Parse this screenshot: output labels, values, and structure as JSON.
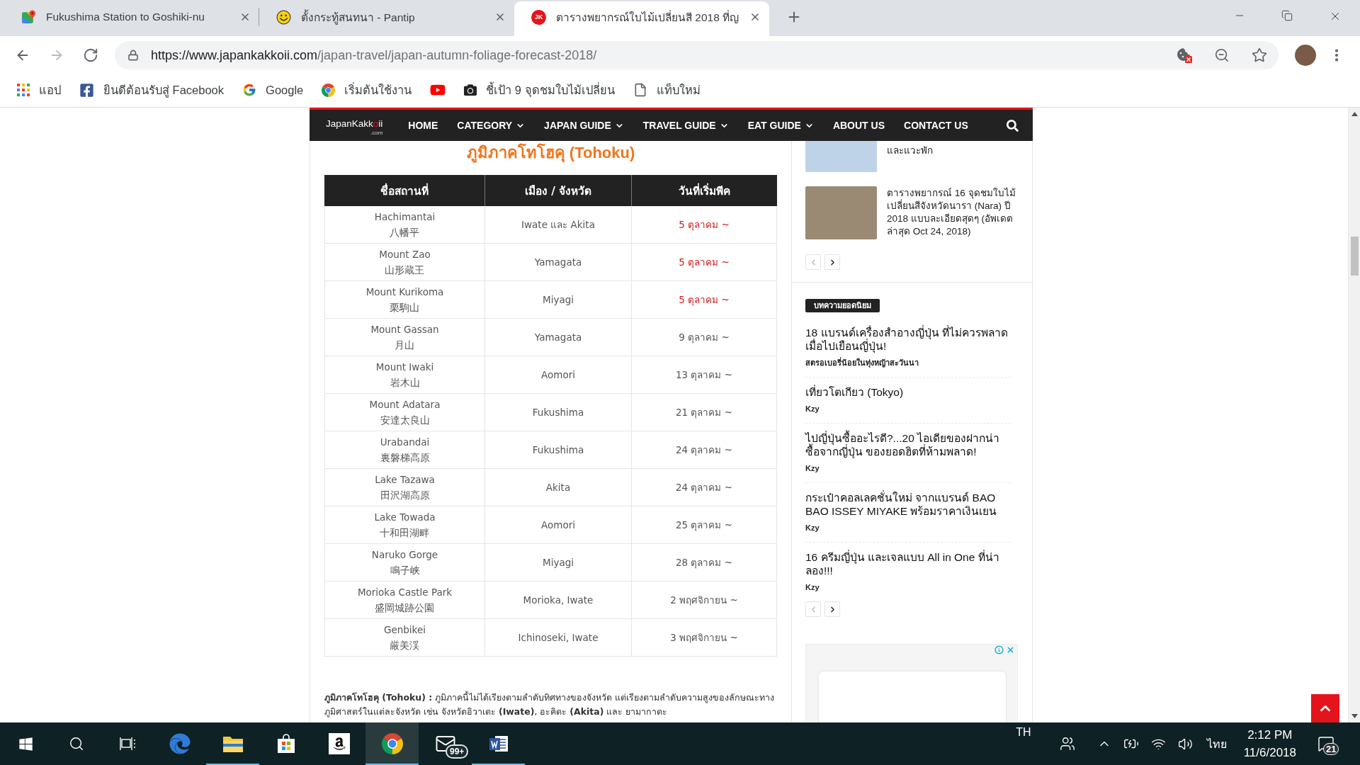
{
  "browser": {
    "tabs": [
      {
        "kind": "maps",
        "title": "Fukushima Station to Goshiki-nu",
        "selected": false
      },
      {
        "kind": "pantip",
        "title": "ตั้งกระทู้สนทนา - Pantip",
        "selected": false
      },
      {
        "kind": "site",
        "favicon_text": "JK",
        "title": "ตารางพยากรณ์ใบไม้เปลี่ยนสี 2018 ที่ญ",
        "selected": true
      }
    ],
    "nav_buttons": [
      {
        "kind": "back",
        "disabled": false
      },
      {
        "kind": "forward",
        "disabled": true
      },
      {
        "kind": "reload",
        "disabled": false
      }
    ],
    "address": {
      "host": "https://www.japankakkoii.com",
      "path": "/japan-travel/japan-autumn-foliage-forecast-2018/"
    },
    "bookmarks": [
      {
        "kind": "apps",
        "label": "แอป"
      },
      {
        "kind": "facebook",
        "label": "ยินดีต้อนรับสู่ Facebook"
      },
      {
        "kind": "google",
        "label": "Google"
      },
      {
        "kind": "chrome",
        "label": "เริ่มต้นใช้งาน"
      },
      {
        "kind": "youtube"
      },
      {
        "kind": "camera",
        "label": "ชี้เป้า 9 จุดชมใบไม้เปลี่ยน"
      },
      {
        "kind": "page",
        "label": "แท็บใหม่"
      }
    ]
  },
  "site": {
    "logo": {
      "text": "JapanKakkoii",
      "sub": ".com"
    },
    "nav": [
      {
        "label": "HOME",
        "dropdown": false
      },
      {
        "label": "CATEGORY",
        "dropdown": true
      },
      {
        "label": "JAPAN GUIDE",
        "dropdown": true
      },
      {
        "label": "TRAVEL GUIDE",
        "dropdown": true
      },
      {
        "label": "EAT GUIDE",
        "dropdown": true
      },
      {
        "label": "ABOUT US",
        "dropdown": false
      },
      {
        "label": "CONTACT US",
        "dropdown": false
      }
    ]
  },
  "article": {
    "heading": "ภูมิภาคโทโฮคุ (Tohoku)",
    "table": {
      "columns": [
        "ชื่อสถานที่",
        "เมือง / จังหวัด",
        "วันที่เริ่มพีค"
      ],
      "rows": [
        {
          "name": "Hachimantai",
          "name_ja": "八幡平",
          "area": "Iwate และ Akita",
          "date": "5 ตุลาคม ~",
          "highlighted": true
        },
        {
          "name": "Mount Zao",
          "name_ja": "山形蔵王",
          "area": "Yamagata",
          "date": "5 ตุลาคม ~",
          "highlighted": true
        },
        {
          "name": "Mount Kurikoma",
          "name_ja": "栗駒山",
          "area": "Miyagi",
          "date": "5 ตุลาคม ~",
          "highlighted": true
        },
        {
          "name": "Mount Gassan",
          "name_ja": "月山",
          "area": "Yamagata",
          "date": "9 ตุลาคม ~",
          "highlighted": false
        },
        {
          "name": "Mount Iwaki",
          "name_ja": "岩木山",
          "area": "Aomori",
          "date": "13 ตุลาคม ~",
          "highlighted": false
        },
        {
          "name": "Mount Adatara",
          "name_ja": "安達太良山",
          "area": "Fukushima",
          "date": "21 ตุลาคม ~",
          "highlighted": false
        },
        {
          "name": "Urabandai",
          "name_ja": "裏磐梯高原",
          "area": "Fukushima",
          "date": "24 ตุลาคม ~",
          "highlighted": false
        },
        {
          "name": "Lake Tazawa",
          "name_ja": "田沢湖高原",
          "area": "Akita",
          "date": "24 ตุลาคม ~",
          "highlighted": false
        },
        {
          "name": "Lake Towada",
          "name_ja": "十和田湖畔",
          "area": "Aomori",
          "date": "25 ตุลาคม ~",
          "highlighted": false
        },
        {
          "name": "Naruko Gorge",
          "name_ja": "鳴子峡",
          "area": "Miyagi",
          "date": "28 ตุลาคม ~",
          "highlighted": false
        },
        {
          "name": "Morioka Castle Park",
          "name_ja": "盛岡城跡公園",
          "area": "Morioka, Iwate",
          "date": "2 พฤศจิกายน ~",
          "highlighted": false
        },
        {
          "name": "Genbikei",
          "name_ja": "厳美渓",
          "area": "Ichinoseki, Iwate",
          "date": "3 พฤศจิกายน ~",
          "highlighted": false
        }
      ]
    },
    "paragraph": "**ภูมิภาคโทโฮคุ (Tohoku) :** ภูมิภาคนี้ไม่ได้เรียงตามลำดับทิศทางของจังหวัด แต่เรียงตามลำดับความสูงของลักษณะทางภูมิศาสตร์ในแต่ละจังหวัด เช่น จังหวัดอิวาเตะ **(Iwate)**, อะคิตะ **(Akita)** และ ยามากาตะ"
  },
  "sidebar": {
    "related": [
      {
        "kind": "clipped",
        "title": "และแวะพัก"
      },
      {
        "kind": "full",
        "title": "ตารางพยากรณ์ 16 จุดชมใบไม้เปลี่ยนสีจังหวัดนารา (Nara) ปี 2018 แบบละเอียดสุดๆ (อัพเดตล่าสุด Oct 24, 2018)"
      }
    ],
    "related_pager": [
      {
        "kind": "prev",
        "disabled": true
      },
      {
        "kind": "next",
        "disabled": false
      }
    ],
    "popular": {
      "heading": "บทความยอดนิยม",
      "items": [
        {
          "title": "18 แบรนด์เครื่องสำอางญี่ปุ่น ที่ไม่ควรพลาดเมื่อไปเยือนญี่ปุ่น!",
          "author": "สตรอเบอรี่น้อยในทุ่งหญ้าสะวันนา"
        },
        {
          "title": "เที่ยวโตเกียว (Tokyo)",
          "author": "Kzy"
        },
        {
          "title": "ไปญี่ปุ่นซื้ออะไรดี?...20 ไอเดียของฝากน่าซื้อจากญี่ปุ่น ของยอดฮิตที่ห้ามพลาด!",
          "author": "Kzy"
        },
        {
          "title": "กระเป๋าคอลเลคชั่นใหม่ จากแบรนด์ BAO BAO ISSEY MIYAKE พร้อมราคาเงินเยน",
          "author": "Kzy"
        },
        {
          "title": "16 ครีมญี่ปุ่น และเจลแบบ All in One ที่น่าลอง!!!",
          "author": "Kzy"
        }
      ]
    },
    "popular_pager": [
      {
        "kind": "prev",
        "disabled": true
      },
      {
        "kind": "next",
        "disabled": false
      }
    ]
  },
  "taskbar": {
    "apps": [
      {
        "kind": "start",
        "running": false,
        "active": false
      },
      {
        "kind": "search",
        "running": false,
        "active": false
      },
      {
        "kind": "taskview",
        "running": false,
        "active": false
      },
      {
        "kind": "edge",
        "running": false,
        "active": false
      },
      {
        "kind": "explorer",
        "running": true,
        "active": false
      },
      {
        "kind": "store",
        "running": false,
        "active": false
      },
      {
        "kind": "amazon",
        "running": false,
        "active": false
      },
      {
        "kind": "chrome",
        "running": true,
        "active": true
      },
      {
        "kind": "mail",
        "running": false,
        "active": false,
        "badge": "99+"
      },
      {
        "kind": "word",
        "running": true,
        "active": false
      }
    ],
    "language": "TH",
    "input_language": "ไทย",
    "time": "2:12 PM",
    "date": "11/6/2018",
    "notifications": "21"
  }
}
